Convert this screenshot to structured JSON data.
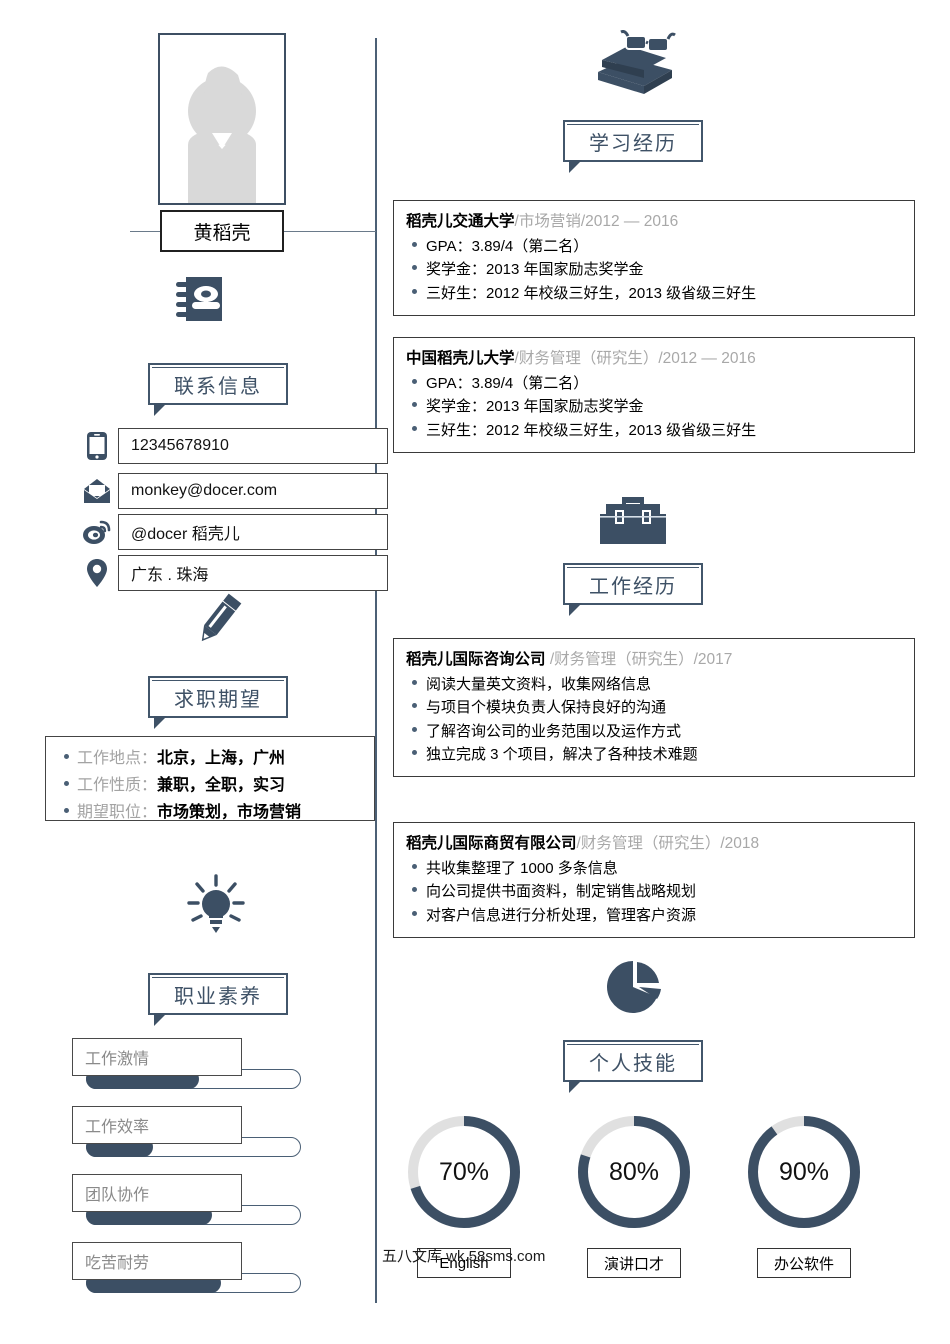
{
  "profile": {
    "name": "黄稻壳",
    "photo_alt": "person-photo-placeholder"
  },
  "contact": {
    "heading": "联系信息",
    "icon": "phone-book-icon",
    "items": [
      {
        "icon": "mobile-phone-icon",
        "value": "12345678910"
      },
      {
        "icon": "envelope-icon",
        "value": "monkey@docer.com"
      },
      {
        "icon": "weibo-icon",
        "value": "@docer 稻壳儿"
      },
      {
        "icon": "location-pin-icon",
        "value": "广东 . 珠海"
      }
    ]
  },
  "expectation": {
    "heading": "求职期望",
    "icon": "pencil-icon",
    "items": [
      {
        "key": "工作地点：",
        "value": "北京，上海，广州"
      },
      {
        "key": "工作性质：",
        "value": "兼职，全职，实习"
      },
      {
        "key": "期望职位：",
        "value": "市场策划，市场营销"
      }
    ]
  },
  "qualities": {
    "heading": "职业素养",
    "icon": "lightbulb-icon",
    "items": [
      {
        "label": "工作激情",
        "percent": 52
      },
      {
        "label": "工作效率",
        "percent": 31
      },
      {
        "label": "团队协作",
        "percent": 58
      },
      {
        "label": "吃苦耐劳",
        "percent": 62
      }
    ]
  },
  "education": {
    "heading": "学习经历",
    "icon": "books-glasses-icon",
    "entries": [
      {
        "org": "稻壳儿交通大学",
        "meta": "/市场营销/2012 — 2016",
        "bullets": [
          "GPA：3.89/4（第二名）",
          "奖学金：2013 年国家励志奖学金",
          "三好生：2012 年校级三好生，2013 级省级三好生"
        ]
      },
      {
        "org": "中国稻壳儿大学",
        "meta": "/财务管理（研究生）/2012 — 2016",
        "bullets": [
          "GPA：3.89/4（第二名）",
          "奖学金：2013 年国家励志奖学金",
          "三好生：2012 年校级三好生，2013 级省级三好生"
        ]
      }
    ]
  },
  "work": {
    "heading": "工作经历",
    "icon": "briefcase-icon",
    "entries": [
      {
        "org": "稻壳儿国际咨询公司",
        "meta": " /财务管理（研究生）/2017",
        "bullets": [
          "阅读大量英文资料，收集网络信息",
          "与项目个模块负责人保持良好的沟通",
          "了解咨询公司的业务范围以及运作方式",
          "独立完成 3 个项目，解决了各种技术难题"
        ]
      },
      {
        "org": "稻壳儿国际商贸有限公司",
        "meta": "/财务管理（研究生）/2018",
        "bullets": [
          "共收集整理了 1000 多条信息",
          "向公司提供书面资料，制定销售战略规划",
          "对客户信息进行分析处理，管理客户资源"
        ]
      }
    ]
  },
  "skills": {
    "heading": "个人技能",
    "icon": "pie-chart-icon",
    "items": [
      {
        "label": "English",
        "percent": 70,
        "display": "70%"
      },
      {
        "label": "演讲口才",
        "percent": 80,
        "display": "80%"
      },
      {
        "label": "办公软件",
        "percent": 90,
        "display": "90%"
      }
    ]
  },
  "watermark": "五八文库 wk.58sms.com",
  "colors": {
    "accent": "#3c4f64",
    "accent_light": "#4a5f75",
    "muted_text": "#a3a3a3",
    "track": "#e0e0e0"
  },
  "chart_data": [
    {
      "type": "bar",
      "title": "职业素养",
      "categories": [
        "工作激情",
        "工作效率",
        "团队协作",
        "吃苦耐劳"
      ],
      "values": [
        52,
        31,
        58,
        62
      ],
      "xlabel": "",
      "ylabel": "",
      "ylim": [
        0,
        100
      ]
    },
    {
      "type": "pie",
      "title": "个人技能",
      "categories": [
        "English",
        "演讲口才",
        "办公软件"
      ],
      "values": [
        70,
        80,
        90
      ],
      "ylim": [
        0,
        100
      ]
    }
  ]
}
